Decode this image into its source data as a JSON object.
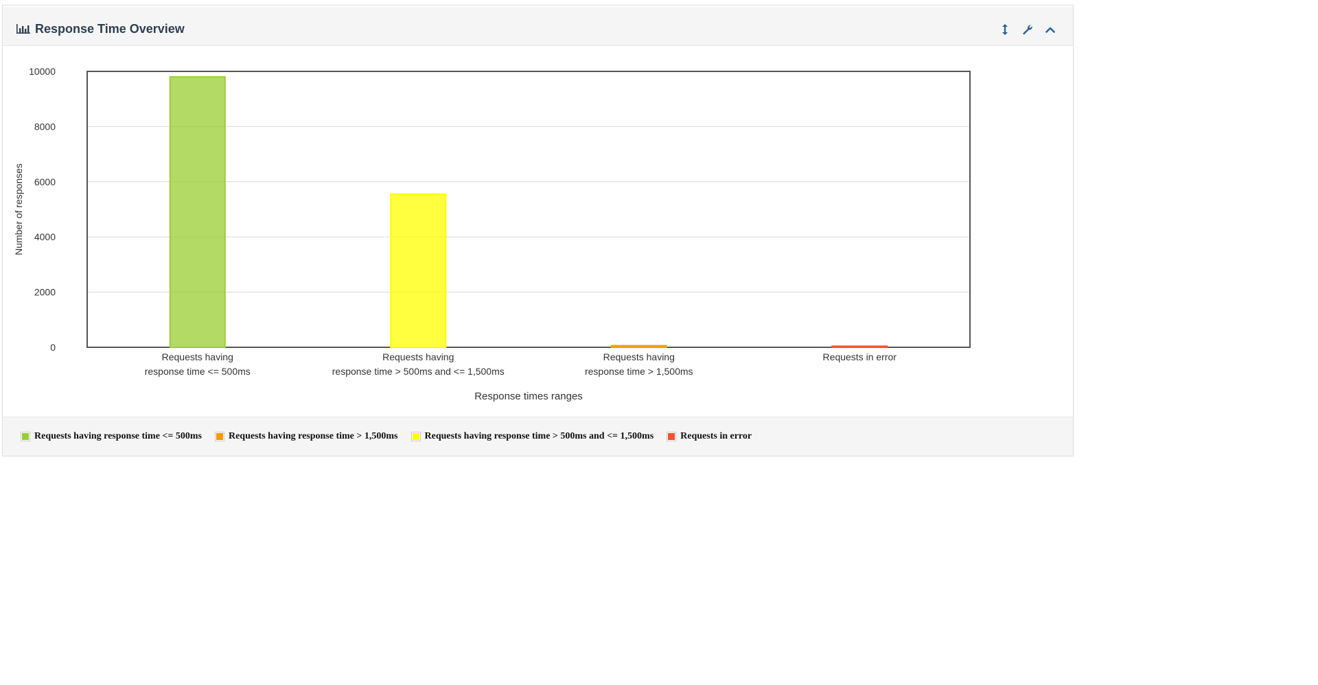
{
  "panel": {
    "title": "Response Time Overview",
    "tools": {
      "resize_icon": "vertical-resize-icon",
      "settings_icon": "wrench-icon",
      "collapse_icon": "chevron-up-icon"
    }
  },
  "chart_data": {
    "type": "bar",
    "title": "",
    "xlabel": "Response times ranges",
    "ylabel": "Number of responses",
    "ylim": [
      0,
      10000
    ],
    "yticks": [
      "0",
      "2000",
      "4000",
      "6000",
      "8000",
      "10000"
    ],
    "grid": true,
    "legend_position": "bottom",
    "categories": [
      [
        "Requests having",
        "response time <= 500ms"
      ],
      [
        "Requests having",
        "response time > 500ms and <= 1,500ms"
      ],
      [
        "Requests having",
        "response time > 1,500ms"
      ],
      [
        "Requests in error"
      ]
    ],
    "series": [
      {
        "name": "Requests having response time <= 500ms",
        "color": "#9acd32",
        "values": [
          9800,
          0,
          0,
          0
        ]
      },
      {
        "name": "Requests having response time > 1,500ms",
        "color": "#ff9900",
        "values": [
          0,
          0,
          60,
          0
        ]
      },
      {
        "name": "Requests having response time > 500ms and <= 1,500ms",
        "color": "#ffff00",
        "values": [
          0,
          5550,
          0,
          0
        ]
      },
      {
        "name": "Requests in error",
        "color": "#ff4f32",
        "values": [
          0,
          0,
          0,
          40
        ]
      }
    ]
  }
}
